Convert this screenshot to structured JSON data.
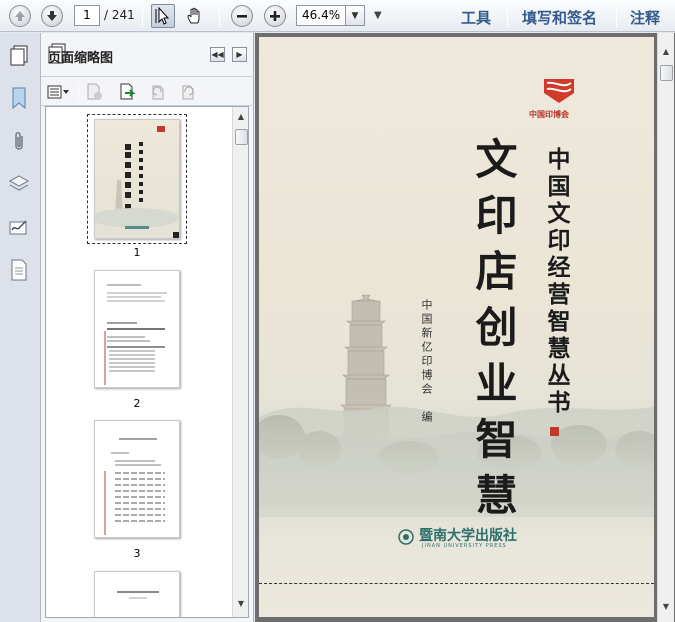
{
  "toolbar": {
    "page_current": "1",
    "page_total": "/ 241",
    "zoom": "46.4%",
    "tools_label": "工具",
    "fill_sign_label": "填写和签名",
    "comment_label": "注释"
  },
  "panel": {
    "title": "页面缩略图",
    "thumbnails": [
      {
        "label": "1"
      },
      {
        "label": "2"
      },
      {
        "label": "3"
      }
    ]
  },
  "document": {
    "series_title": "中国文印经营智慧丛书",
    "main_title": "文印店创业智慧",
    "editor": "中国新亿印博会　编",
    "logo_text": "中国印博会",
    "publisher": "暨南大学出版社",
    "publisher_en": "JINAN UNIVERSITY PRESS"
  }
}
